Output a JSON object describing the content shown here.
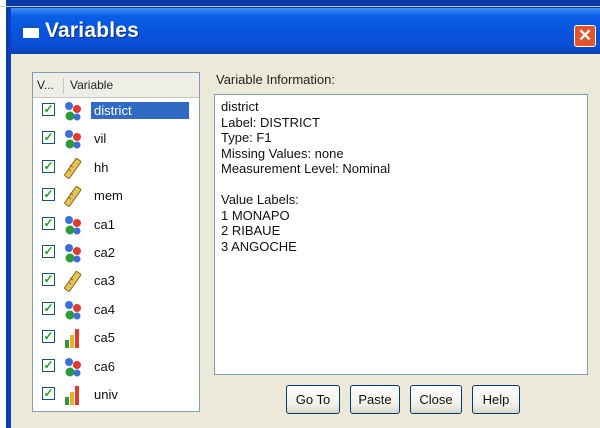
{
  "window": {
    "title": "Variables",
    "close_glyph": "✕"
  },
  "list": {
    "header_v": "V...",
    "header_variable": "Variable",
    "rows": [
      {
        "name": "district",
        "icon": "nominal-icon",
        "checked": true,
        "selected": true
      },
      {
        "name": "vil",
        "icon": "nominal-icon",
        "checked": true,
        "selected": false
      },
      {
        "name": "hh",
        "icon": "scale-icon",
        "checked": true,
        "selected": false
      },
      {
        "name": "mem",
        "icon": "scale-icon",
        "checked": true,
        "selected": false
      },
      {
        "name": "ca1",
        "icon": "nominal-icon",
        "checked": true,
        "selected": false
      },
      {
        "name": "ca2",
        "icon": "nominal-icon",
        "checked": true,
        "selected": false
      },
      {
        "name": "ca3",
        "icon": "scale-icon",
        "checked": true,
        "selected": false
      },
      {
        "name": "ca4",
        "icon": "nominal-icon",
        "checked": true,
        "selected": false
      },
      {
        "name": "ca5",
        "icon": "ordinal-icon",
        "checked": true,
        "selected": false
      },
      {
        "name": "ca6",
        "icon": "nominal-icon",
        "checked": true,
        "selected": false
      },
      {
        "name": "univ",
        "icon": "ordinal-icon",
        "checked": true,
        "selected": false
      }
    ]
  },
  "info": {
    "label": "Variable Information:",
    "lines": [
      "district",
      "Label:  DISTRICT",
      "Type:  F1",
      "Missing Values:  none",
      "Measurement Level:  Nominal",
      "",
      "Value Labels:",
      "1 MONAPO",
      "2 RIBAUE",
      "3 ANGOCHE"
    ]
  },
  "buttons": {
    "goto": "Go To",
    "paste": "Paste",
    "close": "Close",
    "help": "Help"
  },
  "colors": {
    "titlebar": "#0654de",
    "selection": "#316ac5",
    "close_button": "#e4532b",
    "checkmark": "#21a121"
  }
}
